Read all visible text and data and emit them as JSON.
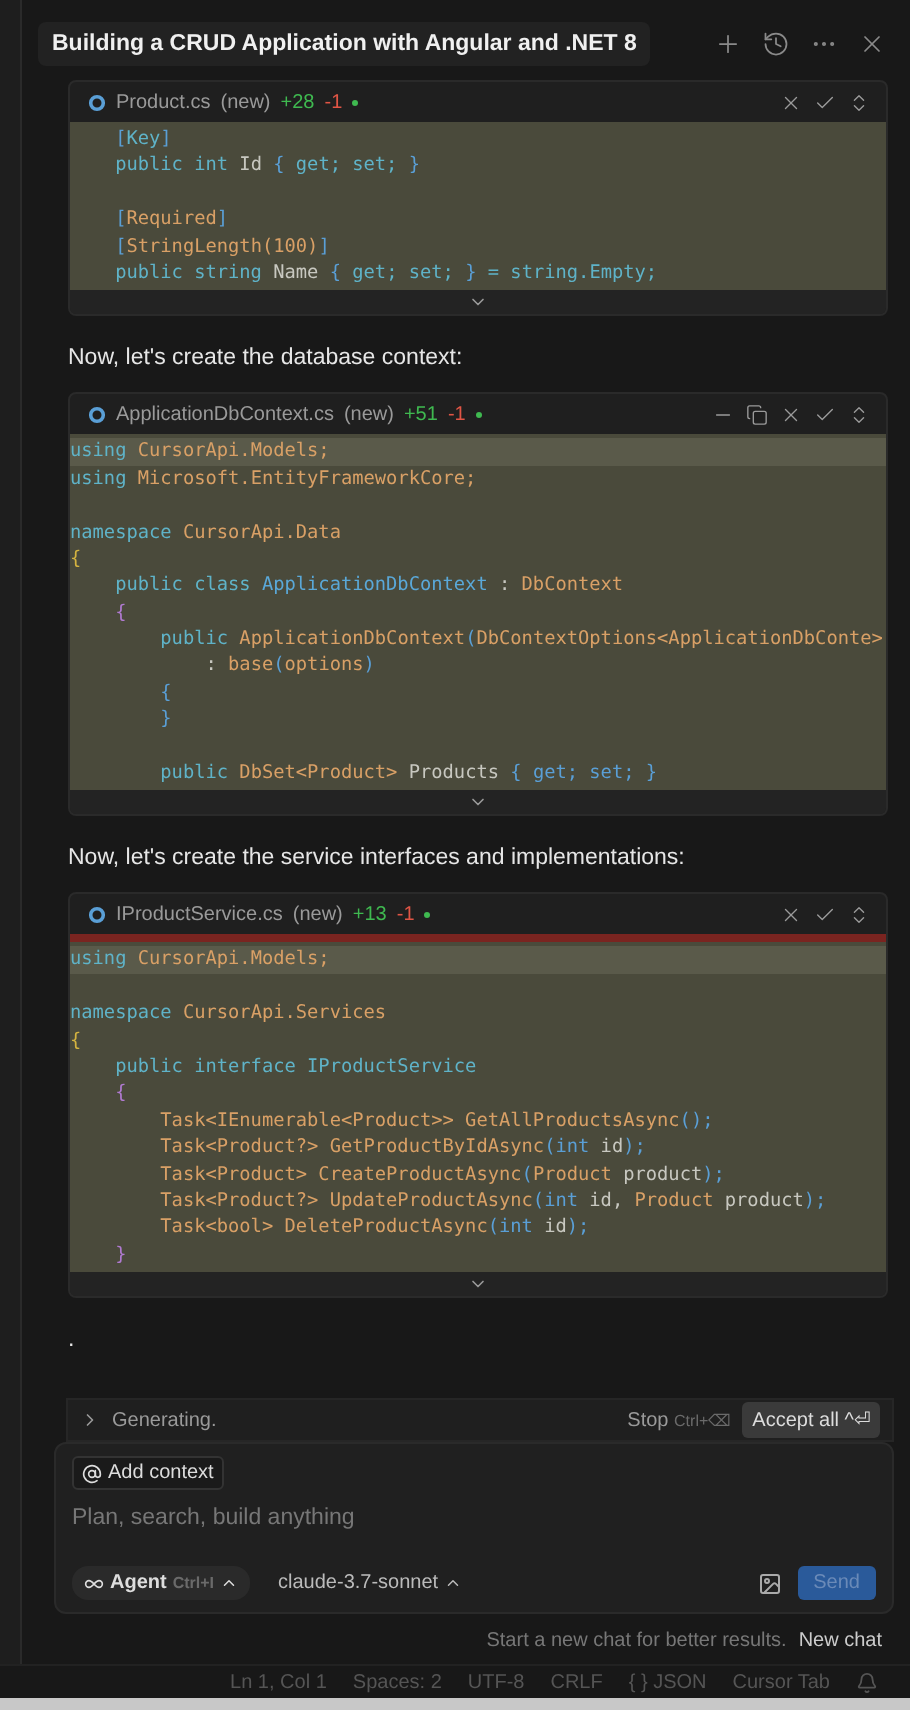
{
  "chat": {
    "title": "Building a CRUD Application with Angular and .NET 8",
    "actions": [
      {
        "kind": "new"
      },
      {
        "kind": "history"
      },
      {
        "kind": "more"
      },
      {
        "kind": "close"
      }
    ]
  },
  "messages": [
    {
      "kind": "code",
      "file": "Product.cs",
      "tag": "(new)",
      "added": "+28",
      "removed": "-1",
      "actions": [
        {
          "kind": "close"
        },
        {
          "kind": "accept"
        },
        {
          "kind": "updown"
        }
      ],
      "deleted_bar": false,
      "lines": [
        {
          "highlighted": false,
          "tokens": [
            {
              "text": "    [",
              "color": "#5a9fd6"
            },
            {
              "text": "Key",
              "color": "#5fb3c8"
            },
            {
              "text": "]",
              "color": "#5a9fd6"
            }
          ]
        },
        {
          "highlighted": false,
          "tokens": [
            {
              "text": "    public int ",
              "color": "#5fb3c8"
            },
            {
              "text": "Id ",
              "color": "#c8c8c0"
            },
            {
              "text": "{ ",
              "color": "#5a9fd6"
            },
            {
              "text": "get; set; ",
              "color": "#5fb3c8"
            },
            {
              "text": "}",
              "color": "#5a9fd6"
            }
          ]
        },
        {
          "highlighted": false
        },
        {
          "highlighted": false,
          "tokens": [
            {
              "text": "    [",
              "color": "#5a9fd6"
            },
            {
              "text": "Required",
              "color": "#d9a066"
            },
            {
              "text": "]",
              "color": "#5a9fd6"
            }
          ]
        },
        {
          "highlighted": false,
          "tokens": [
            {
              "text": "    [",
              "color": "#5a9fd6"
            },
            {
              "text": "StringLength(100)",
              "color": "#d9a066"
            },
            {
              "text": "]",
              "color": "#5a9fd6"
            }
          ]
        },
        {
          "highlighted": false,
          "tokens": [
            {
              "text": "    public string ",
              "color": "#5fb3c8"
            },
            {
              "text": "Name ",
              "color": "#c8c8c0"
            },
            {
              "text": "{ ",
              "color": "#5a9fd6"
            },
            {
              "text": "get; set; ",
              "color": "#5fb3c8"
            },
            {
              "text": "} ",
              "color": "#5a9fd6"
            },
            {
              "text": "= string.Empty;",
              "color": "#5fb3c8"
            }
          ]
        }
      ]
    },
    {
      "kind": "text",
      "text": "Now, let's create the database context:"
    },
    {
      "kind": "code",
      "file": "ApplicationDbContext.cs",
      "tag": "(new)",
      "added": "+51",
      "removed": "-1",
      "actions": [
        {
          "kind": "minimize"
        },
        {
          "kind": "copy"
        },
        {
          "kind": "close"
        },
        {
          "kind": "accept"
        },
        {
          "kind": "updown"
        }
      ],
      "deleted_bar": false,
      "lines": [
        {
          "highlighted": true,
          "tokens": [
            {
              "text": "using ",
              "color": "#5fb3c8"
            },
            {
              "text": "CursorApi.Models;",
              "color": "#d9a066"
            }
          ]
        },
        {
          "highlighted": false,
          "tokens": [
            {
              "text": "using ",
              "color": "#5fb3c8"
            },
            {
              "text": "Microsoft.EntityFrameworkCore;",
              "color": "#d9a066"
            }
          ]
        },
        {
          "highlighted": false
        },
        {
          "highlighted": false,
          "tokens": [
            {
              "text": "namespace ",
              "color": "#5fb3c8"
            },
            {
              "text": "CursorApi.Data",
              "color": "#d9a066"
            }
          ]
        },
        {
          "highlighted": false,
          "tokens": [
            {
              "text": "{",
              "color": "#d4b340"
            }
          ]
        },
        {
          "highlighted": false,
          "tokens": [
            {
              "text": "    public class ",
              "color": "#5fb3c8"
            },
            {
              "text": "ApplicationDbContext ",
              "color": "#5aa8d8"
            },
            {
              "text": ": ",
              "color": "#c8c8c0"
            },
            {
              "text": "DbContext",
              "color": "#d9a066"
            }
          ]
        },
        {
          "highlighted": false,
          "tokens": [
            {
              "text": "    {",
              "color": "#b07ad0"
            }
          ]
        },
        {
          "highlighted": false,
          "tokens": [
            {
              "text": "        public ",
              "color": "#5fb3c8"
            },
            {
              "text": "ApplicationDbContext",
              "color": "#d9a066"
            },
            {
              "text": "(",
              "color": "#5a9fd6"
            },
            {
              "text": "DbContextOptions<ApplicationDbConte>",
              "color": "#d9a066"
            }
          ]
        },
        {
          "highlighted": false,
          "tokens": [
            {
              "text": "            : ",
              "color": "#c8c8c0"
            },
            {
              "text": "base",
              "color": "#d9a066"
            },
            {
              "text": "(",
              "color": "#5a9fd6"
            },
            {
              "text": "options",
              "color": "#d9a066"
            },
            {
              "text": ")",
              "color": "#5a9fd6"
            }
          ]
        },
        {
          "highlighted": false,
          "tokens": [
            {
              "text": "        {",
              "color": "#5a9fd6"
            }
          ]
        },
        {
          "highlighted": false,
          "tokens": [
            {
              "text": "        }",
              "color": "#5a9fd6"
            }
          ]
        },
        {
          "highlighted": false
        },
        {
          "highlighted": false,
          "tokens": [
            {
              "text": "        public ",
              "color": "#5fb3c8"
            },
            {
              "text": "DbSet<Product> ",
              "color": "#d9a066"
            },
            {
              "text": "Products ",
              "color": "#c8c8c0"
            },
            {
              "text": "{ get; set; }",
              "color": "#5a9fd6"
            }
          ]
        }
      ]
    },
    {
      "kind": "text",
      "text": "Now, let's create the service interfaces and implementations:"
    },
    {
      "kind": "code",
      "file": "IProductService.cs",
      "tag": "(new)",
      "added": "+13",
      "removed": "-1",
      "actions": [
        {
          "kind": "close"
        },
        {
          "kind": "accept"
        },
        {
          "kind": "updown"
        }
      ],
      "deleted_bar": true,
      "lines": [
        {
          "highlighted": true,
          "tokens": [
            {
              "text": "using ",
              "color": "#5fb3c8"
            },
            {
              "text": "CursorApi.Models;",
              "color": "#d9a066"
            }
          ]
        },
        {
          "highlighted": false
        },
        {
          "highlighted": false,
          "tokens": [
            {
              "text": "namespace ",
              "color": "#5fb3c8"
            },
            {
              "text": "CursorApi.Services",
              "color": "#d9a066"
            }
          ]
        },
        {
          "highlighted": false,
          "tokens": [
            {
              "text": "{",
              "color": "#d4b340"
            }
          ]
        },
        {
          "highlighted": false,
          "tokens": [
            {
              "text": "    public interface ",
              "color": "#5fb3c8"
            },
            {
              "text": "IProductService",
              "color": "#5fb3c8"
            }
          ]
        },
        {
          "highlighted": false,
          "tokens": [
            {
              "text": "    {",
              "color": "#b07ad0"
            }
          ]
        },
        {
          "highlighted": false,
          "tokens": [
            {
              "text": "        Task<IEnumerable<Product>> GetAllProductsAsync",
              "color": "#d9a066"
            },
            {
              "text": "();",
              "color": "#5a9fd6"
            }
          ]
        },
        {
          "highlighted": false,
          "tokens": [
            {
              "text": "        Task<Product?> GetProductByIdAsync",
              "color": "#d9a066"
            },
            {
              "text": "(int ",
              "color": "#5a9fd6"
            },
            {
              "text": "id",
              "color": "#c8c8c0"
            },
            {
              "text": ");",
              "color": "#5a9fd6"
            }
          ]
        },
        {
          "highlighted": false,
          "tokens": [
            {
              "text": "        Task<Product> CreateProductAsync",
              "color": "#d9a066"
            },
            {
              "text": "(",
              "color": "#5a9fd6"
            },
            {
              "text": "Product ",
              "color": "#d9a066"
            },
            {
              "text": "product",
              "color": "#c8c8c0"
            },
            {
              "text": ");",
              "color": "#5a9fd6"
            }
          ]
        },
        {
          "highlighted": false,
          "tokens": [
            {
              "text": "        Task<Product?> UpdateProductAsync",
              "color": "#d9a066"
            },
            {
              "text": "(int ",
              "color": "#5a9fd6"
            },
            {
              "text": "id, ",
              "color": "#c8c8c0"
            },
            {
              "text": "Product ",
              "color": "#d9a066"
            },
            {
              "text": "product",
              "color": "#c8c8c0"
            },
            {
              "text": ");",
              "color": "#5a9fd6"
            }
          ]
        },
        {
          "highlighted": false,
          "tokens": [
            {
              "text": "        Task<bool> DeleteProductAsync",
              "color": "#d9a066"
            },
            {
              "text": "(int ",
              "color": "#5a9fd6"
            },
            {
              "text": "id",
              "color": "#c8c8c0"
            },
            {
              "text": ");",
              "color": "#5a9fd6"
            }
          ]
        },
        {
          "highlighted": false,
          "tokens": [
            {
              "text": "    }",
              "color": "#b07ad0"
            }
          ]
        }
      ]
    },
    {
      "kind": "text",
      "text": "."
    }
  ],
  "generating": {
    "label": "Generating.",
    "stop": "Stop",
    "stop_shortcut": "Ctrl+⌫",
    "accept": "Accept all",
    "accept_shortcut": "^⏎"
  },
  "composer": {
    "add_context": "Add context",
    "placeholder": "Plan, search, build anything",
    "mode": "Agent",
    "mode_shortcut": "Ctrl+I",
    "model": "claude-3.7-sonnet",
    "send": "Send"
  },
  "hint": {
    "text": "Start a new chat for better results.",
    "link": "New chat"
  },
  "status_bar": [
    "Ln 1, Col 1",
    "Spaces: 2",
    "UTF-8",
    "CRLF",
    "{ } JSON",
    "Cursor Tab"
  ]
}
